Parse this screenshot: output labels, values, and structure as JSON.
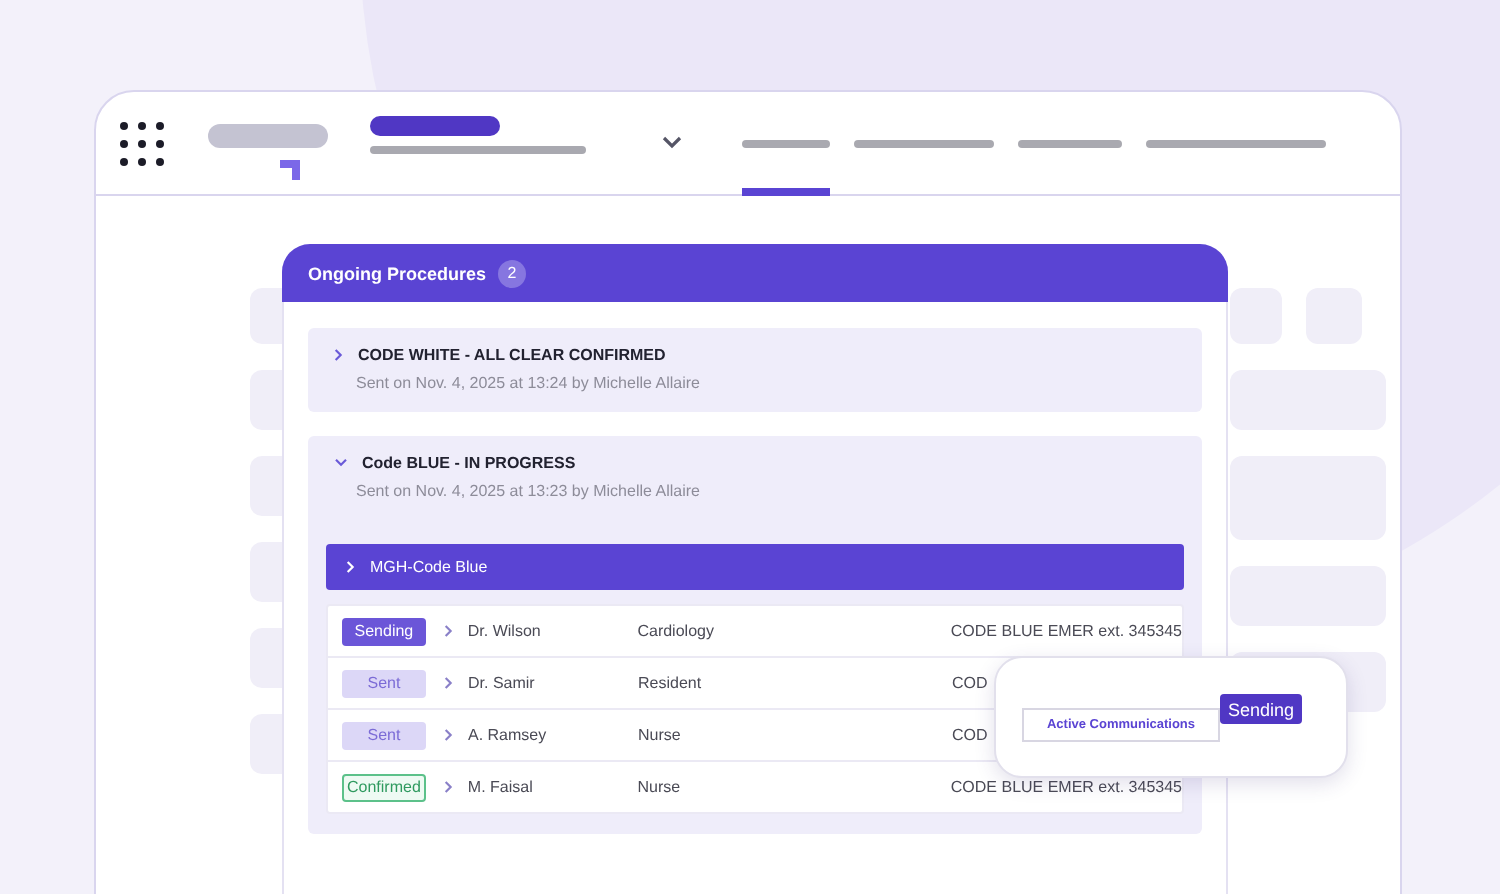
{
  "nav": [
    {
      "selected": true
    },
    {
      "selected": false
    },
    {
      "selected": false
    },
    {
      "selected": false
    }
  ],
  "panel": {
    "title": "Ongoing Procedures",
    "count": "2",
    "procedures": [
      {
        "title": "CODE WHITE - ALL CLEAR CONFIRMED",
        "sent": "Sent on Nov. 4, 2025 at 13:24 by Michelle Allaire",
        "expanded": false
      },
      {
        "title": "Code BLUE - IN PROGRESS",
        "sent": "Sent on Nov. 4, 2025 at 13:23 by Michelle Allaire",
        "expanded": true,
        "group": {
          "name": "MGH-Code Blue",
          "rows": [
            {
              "status": "Sending",
              "kind": "sending",
              "name": "Dr. Wilson",
              "department": "Cardiology",
              "contact": "CODE BLUE EMER ext. 345345"
            },
            {
              "status": "Sent",
              "kind": "sent",
              "name": "Dr. Samir",
              "department": "Resident",
              "contact": "COD"
            },
            {
              "status": "Sent",
              "kind": "sent",
              "name": "A. Ramsey",
              "department": "Nurse",
              "contact": "COD"
            },
            {
              "status": "Confirmed",
              "kind": "confirmed",
              "name": "M. Faisal",
              "department": "Nurse",
              "contact": "CODE BLUE EMER ext. 345345"
            }
          ]
        }
      }
    ]
  },
  "popup": {
    "field": "Active Communications",
    "button": "Sending"
  }
}
